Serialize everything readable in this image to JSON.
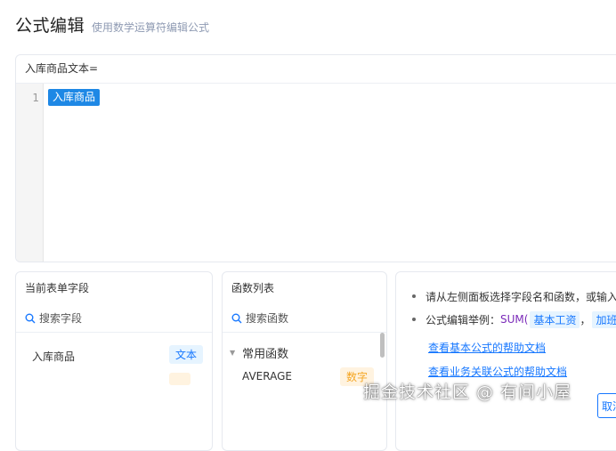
{
  "header": {
    "title": "公式编辑",
    "subtitle": "使用数学运算符编辑公式"
  },
  "editor": {
    "label": "入库商品文本=",
    "line_number": "1",
    "content_field": "入库商品"
  },
  "fields_panel": {
    "title": "当前表单字段",
    "search_placeholder": "搜索字段",
    "items": [
      {
        "name": "入库商品",
        "type": "文本"
      }
    ]
  },
  "functions_panel": {
    "title": "函数列表",
    "search_placeholder": "搜索函数",
    "group": "常用函数",
    "items": [
      {
        "name": "AVERAGE",
        "type": "数字"
      }
    ]
  },
  "help_panel": {
    "tip1": "请从左侧面板选择字段名和函数，或输入",
    "example_prefix": "公式编辑举例：",
    "example_fn": "SUM(",
    "example_chip1": "基本工资",
    "example_sep": "，",
    "example_chip2": "加班",
    "link1": "查看基本公式的帮助文档",
    "link2": "查看业务关联公式的帮助文档"
  },
  "footer": {
    "watermark": "掘金技术社区 @ 有间小屋",
    "cancel_label": "取消"
  },
  "colors": {
    "accent": "#1677ff",
    "chip_blue": "#1e88e5",
    "number_badge": "#f5a623"
  }
}
